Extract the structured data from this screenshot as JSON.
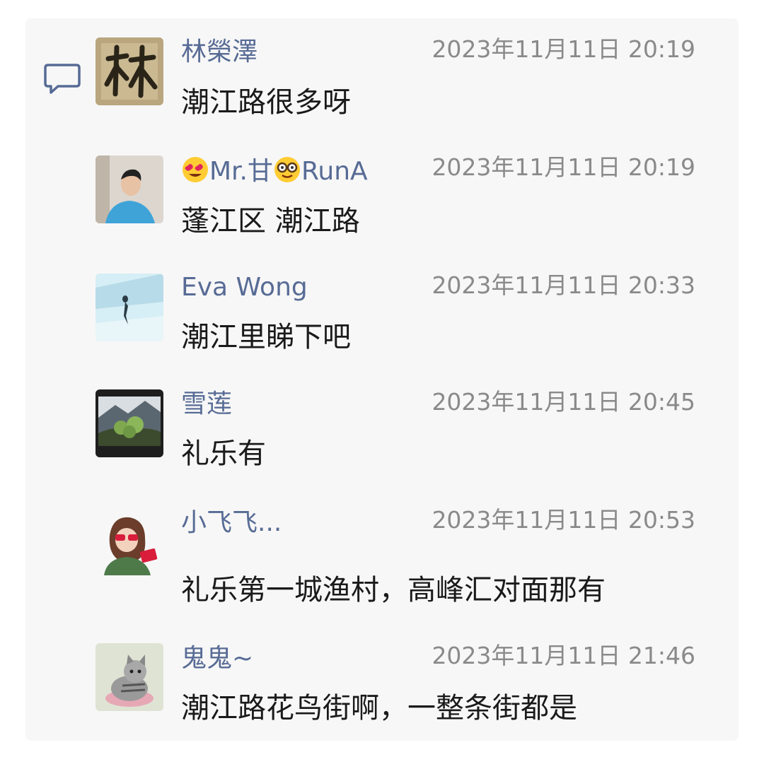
{
  "comments": [
    {
      "name": "林榮澤",
      "time": "2023年11月11日 20:19",
      "text": "潮江路很多呀",
      "avatar_icon": "calligraphy-avatar-icon"
    },
    {
      "name_text_1": "Mr.甘",
      "name_text_2": "RunA",
      "time": "2023年11月11日 20:19",
      "text": "蓬江区 潮江路",
      "avatar_icon": "man-photo-avatar-icon",
      "name_emojis": [
        "heart-eyes-emoji-icon",
        "nerd-face-emoji-icon"
      ]
    },
    {
      "name": "Eva Wong",
      "time": "2023年11月11日 20:33",
      "text": "潮江里睇下吧",
      "avatar_icon": "dancer-avatar-icon"
    },
    {
      "name": "雪莲",
      "time": "2023年11月11日 20:45",
      "text": "礼乐有",
      "avatar_icon": "mountain-plant-avatar-icon"
    },
    {
      "name": "小飞飞...",
      "time": "2023年11月11日 20:53",
      "text": "礼乐第一城渔村，高峰汇对面那有",
      "avatar_icon": "cartoon-girl-avatar-icon"
    },
    {
      "name": "鬼鬼~",
      "time": "2023年11月11日 21:46",
      "text": "潮江路花鸟街啊，一整条街都是",
      "avatar_icon": "cat-avatar-icon"
    }
  ],
  "colors": {
    "panel_background": "#f7f7f7",
    "name_color": "#576b95",
    "time_color": "#8a8a8a",
    "text_color": "#1a1a1a"
  },
  "icons": {
    "comment_section": "comment-bubble-icon"
  }
}
